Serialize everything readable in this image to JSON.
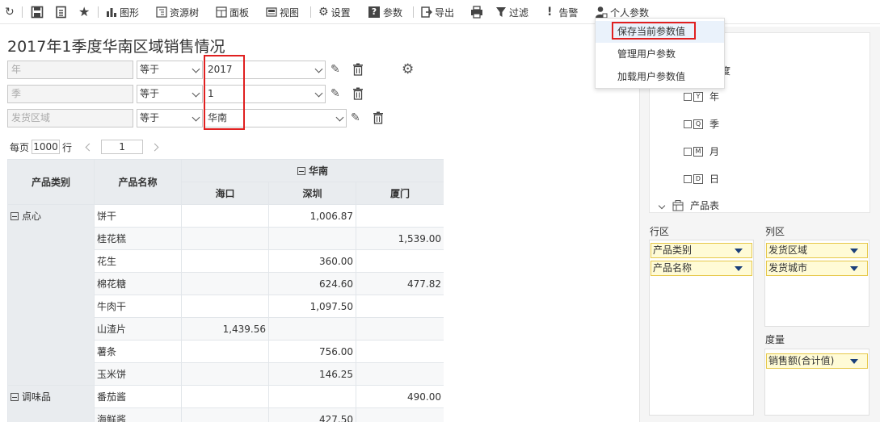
{
  "toolbar": {
    "items": [
      {
        "label": "",
        "icon": "refresh-icon"
      },
      {
        "label": "",
        "icon": "save-icon"
      },
      {
        "label": "",
        "icon": "save-as-icon"
      },
      {
        "label": "",
        "icon": "star-icon"
      },
      {
        "label": "图形",
        "icon": "chart-icon"
      },
      {
        "label": "资源树",
        "icon": "tree-icon"
      },
      {
        "label": "面板",
        "icon": "panel-icon"
      },
      {
        "label": "视图",
        "icon": "view-icon"
      },
      {
        "label": "设置",
        "icon": "gear-icon"
      },
      {
        "label": "参数",
        "icon": "help-param-icon"
      },
      {
        "label": "导出",
        "icon": "export-icon"
      },
      {
        "label": "",
        "icon": "print-icon"
      },
      {
        "label": "过滤",
        "icon": "filter-icon"
      },
      {
        "label": "告警",
        "icon": "alert-icon"
      },
      {
        "label": "个人参数",
        "icon": "user-param-icon"
      }
    ]
  },
  "param_menu": {
    "items": [
      "保存当前参数值",
      "管理用户参数",
      "加载用户参数值"
    ],
    "highlighted": "保存当前参数值"
  },
  "report": {
    "title": "2017年1季度华南区域销售情况"
  },
  "filters": [
    {
      "field": "年",
      "operator": "等于",
      "value": "2017"
    },
    {
      "field": "季",
      "operator": "等于",
      "value": "1"
    },
    {
      "field": "发货区域",
      "operator": "等于",
      "value": "华南"
    }
  ],
  "paging": {
    "prefix": "每页",
    "page_size": "1000",
    "suffix": "行",
    "page": "1"
  },
  "grid": {
    "header_category": "产品类别",
    "header_name": "产品名称",
    "region": "华南",
    "cities": [
      "海口",
      "深圳",
      "厦门"
    ],
    "groups": [
      {
        "category": "点心",
        "rows": [
          {
            "name": "饼干",
            "values": [
              "",
              "1,006.87",
              ""
            ]
          },
          {
            "name": "桂花糕",
            "values": [
              "",
              "",
              "1,539.00"
            ]
          },
          {
            "name": "花生",
            "values": [
              "",
              "360.00",
              ""
            ]
          },
          {
            "name": "棉花糖",
            "values": [
              "",
              "624.60",
              "477.82"
            ]
          },
          {
            "name": "牛肉干",
            "values": [
              "",
              "1,097.50",
              ""
            ]
          },
          {
            "name": "山渣片",
            "values": [
              "1,439.56",
              "",
              ""
            ]
          },
          {
            "name": "薯条",
            "values": [
              "",
              "756.00",
              ""
            ]
          },
          {
            "name": "玉米饼",
            "values": [
              "",
              "146.25",
              ""
            ]
          }
        ]
      },
      {
        "category": "调味品",
        "rows": [
          {
            "name": "番茄酱",
            "values": [
              "",
              "",
              "490.00"
            ]
          },
          {
            "name": "海鲜酱",
            "values": [
              "",
              "427.50",
              ""
            ]
          }
        ]
      }
    ]
  },
  "resource_tree": {
    "partial_label": "度",
    "date_items": [
      {
        "icon": "Y",
        "label": "年"
      },
      {
        "icon": "Q",
        "label": "季"
      },
      {
        "icon": "M",
        "label": "月"
      },
      {
        "icon": "D",
        "label": "日"
      }
    ],
    "table_node": "产品表"
  },
  "zones": {
    "row_label": "行区",
    "row_fields": [
      "产品类别",
      "产品名称"
    ],
    "col_label": "列区",
    "col_fields": [
      "发货区域",
      "发货城市"
    ],
    "measure_label": "度量",
    "measure_fields": [
      "销售额(合计值)"
    ]
  },
  "colors": {
    "highlight_box": "#e02020",
    "chip_bg": "#fffbd6",
    "chip_border": "#e6c84a",
    "header_bg": "#e9ecef"
  }
}
